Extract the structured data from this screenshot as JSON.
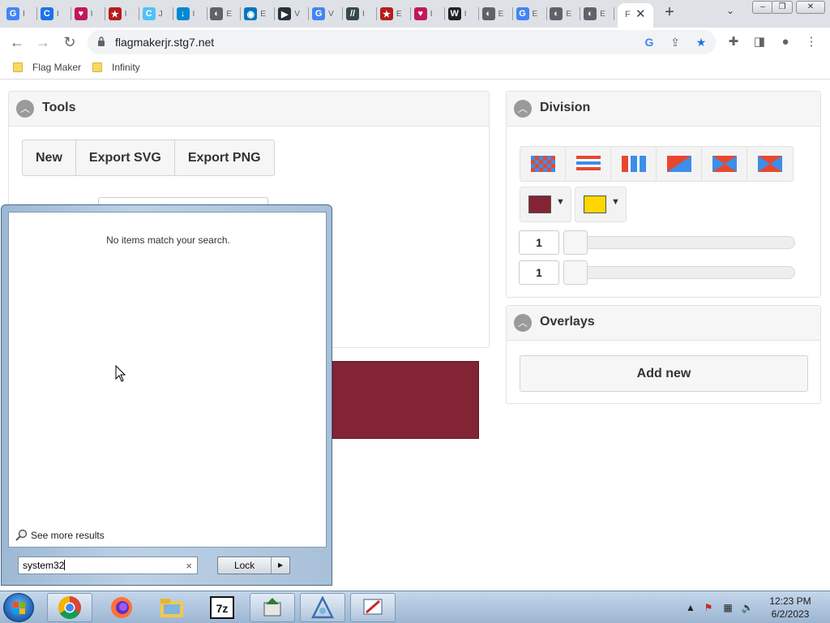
{
  "browser": {
    "tabs": [
      {
        "letter": "G",
        "color": "#4285f4",
        "label": "I"
      },
      {
        "letter": "C",
        "color": "#1a73e8",
        "label": "I"
      },
      {
        "letter": "♥",
        "color": "#c2185b",
        "label": "I"
      },
      {
        "letter": "★",
        "color": "#b71c1c",
        "label": "I"
      },
      {
        "letter": "C",
        "color": "#4fc3f7",
        "label": "J"
      },
      {
        "letter": "↓",
        "color": "#0288d1",
        "label": "I"
      },
      {
        "letter": "◐",
        "color": "#5f6368",
        "label": "E"
      },
      {
        "letter": "◉",
        "color": "#0277bd",
        "label": "E"
      },
      {
        "letter": "▶",
        "color": "#263238",
        "label": "V"
      },
      {
        "letter": "G",
        "color": "#4285f4",
        "label": "V"
      },
      {
        "letter": "//",
        "color": "#37474f",
        "label": "I"
      },
      {
        "letter": "★",
        "color": "#b71c1c",
        "label": "E"
      },
      {
        "letter": "♥",
        "color": "#c2185b",
        "label": "I"
      },
      {
        "letter": "W",
        "color": "#202124",
        "label": "I"
      },
      {
        "letter": "◐",
        "color": "#5f6368",
        "label": "E"
      },
      {
        "letter": "G",
        "color": "#4285f4",
        "label": "E"
      },
      {
        "letter": "◐",
        "color": "#5f6368",
        "label": "E"
      },
      {
        "letter": "◐",
        "color": "#5f6368",
        "label": "E"
      }
    ],
    "active_tab_label": "F",
    "url": "flagmakerjr.stg7.net",
    "bookmarks": [
      "Flag Maker",
      "Infinity"
    ]
  },
  "tools_panel": {
    "title": "Tools",
    "buttons": [
      "New",
      "Export SVG",
      "Export PNG"
    ]
  },
  "division_panel": {
    "title": "Division",
    "colors": [
      "#832435",
      "#ffd700"
    ],
    "value_1": "1",
    "value_2": "1"
  },
  "overlays_panel": {
    "title": "Overlays",
    "add_label": "Add new"
  },
  "flag_color": "#832435",
  "start_menu": {
    "message": "No items match your search.",
    "see_more": "See more results",
    "search_value": "system32",
    "lock_label": "Lock"
  },
  "taskbar": {
    "time": "12:23 PM",
    "date": "6/2/2023"
  }
}
